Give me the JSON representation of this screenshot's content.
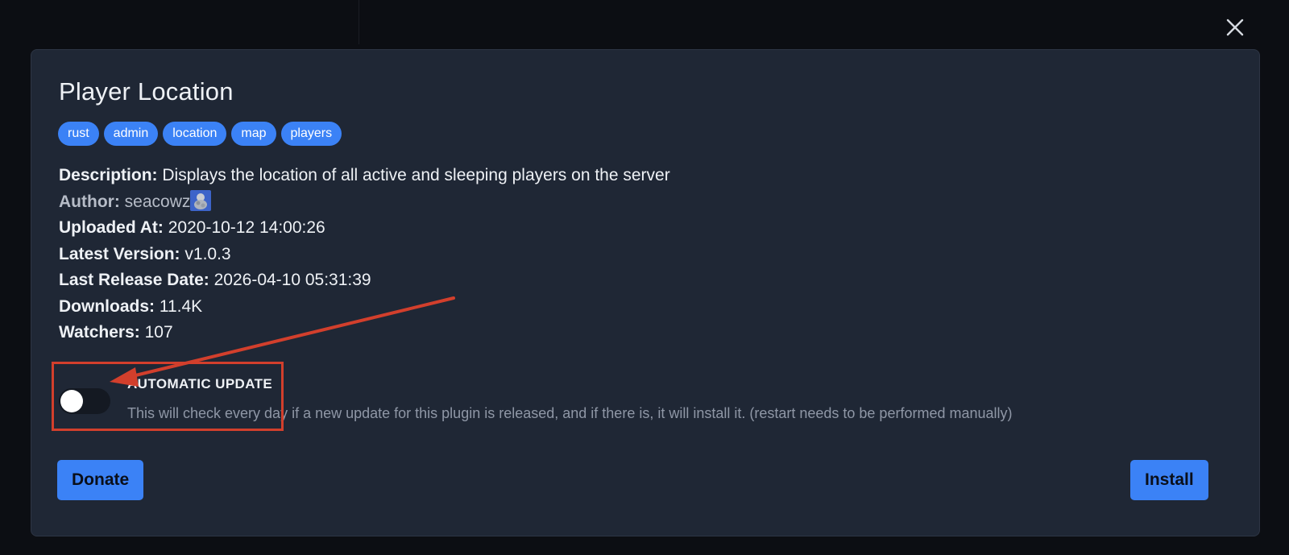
{
  "colors": {
    "accent": "#3b82f6",
    "modal_bg": "#1f2735",
    "annotation": "#d23f2c"
  },
  "modal": {
    "title": "Player Location",
    "tags": [
      "rust",
      "admin",
      "location",
      "map",
      "players"
    ],
    "description": {
      "label": "Description:",
      "value": "Displays the location of all active and sleeping players on the server"
    },
    "author": {
      "label": "Author:",
      "value": "seacowz",
      "avatar_icon": "author-avatar-icon"
    },
    "uploaded_at": {
      "label": "Uploaded At:",
      "value": "2020-10-12 14:00:26"
    },
    "latest_version": {
      "label": "Latest Version:",
      "value": "v1.0.3"
    },
    "last_release_date": {
      "label": "Last Release Date:",
      "value": "2026-04-10 05:31:39"
    },
    "downloads": {
      "label": "Downloads:",
      "value": "11.4K"
    },
    "watchers": {
      "label": "Watchers:",
      "value": "107"
    },
    "automatic_update": {
      "title": "AUTOMATIC UPDATE",
      "description": "This will check every day if a new update for this plugin is released, and if there is, it will install it. (restart needs to be performed manually)",
      "enabled": false
    },
    "donate_label": "Donate",
    "install_label": "Install",
    "close_icon": "close-icon"
  }
}
